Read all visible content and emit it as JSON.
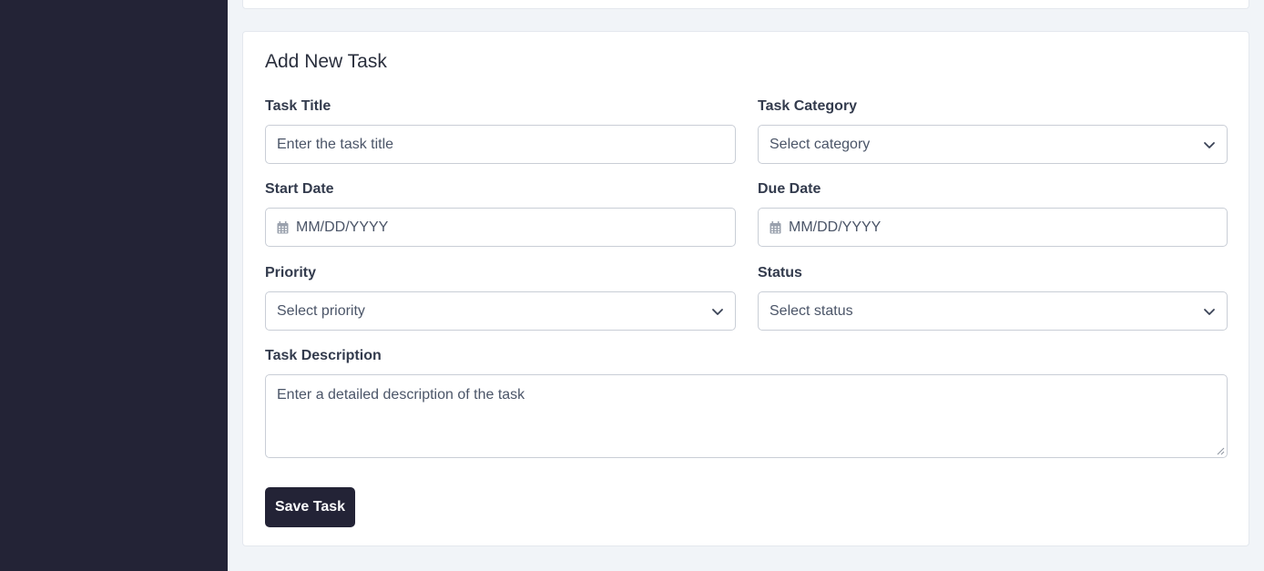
{
  "form": {
    "title": "Add New Task",
    "task_title": {
      "label": "Task Title",
      "placeholder": "Enter the task title"
    },
    "task_category": {
      "label": "Task Category",
      "selected": "Select category"
    },
    "start_date": {
      "label": "Start Date",
      "placeholder": "MM/DD/YYYY"
    },
    "due_date": {
      "label": "Due Date",
      "placeholder": "MM/DD/YYYY"
    },
    "priority": {
      "label": "Priority",
      "selected": "Select priority"
    },
    "status": {
      "label": "Status",
      "selected": "Select status"
    },
    "description": {
      "label": "Task Description",
      "placeholder": "Enter a detailed description of the task"
    },
    "save_label": "Save Task"
  },
  "icons": {
    "calendar": "calendar-icon",
    "chevron": "chevron-down-icon",
    "resize": "resize-handle"
  },
  "colors": {
    "sidebar": "#232336",
    "page_bg": "#f1f4f8",
    "button_bg": "#232336",
    "button_text": "#ffffff"
  }
}
